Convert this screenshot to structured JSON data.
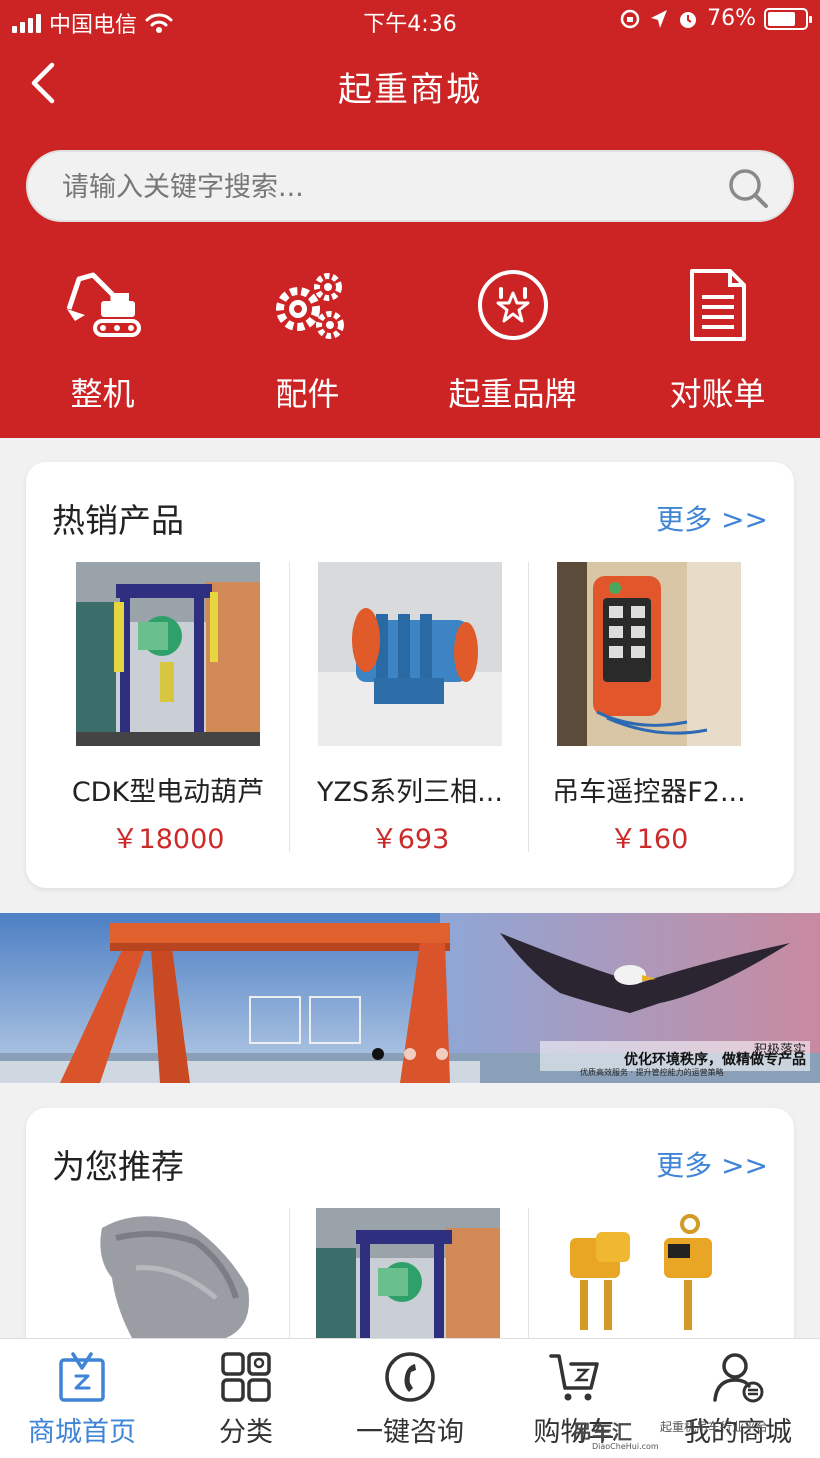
{
  "status_bar": {
    "carrier": "中国电信",
    "time": "下午4:36",
    "battery": "76%"
  },
  "nav": {
    "title": "起重商城"
  },
  "search": {
    "placeholder": "请输入关键字搜索..."
  },
  "quick_entries": [
    {
      "label": "整机",
      "icon": "excavator-icon"
    },
    {
      "label": "配件",
      "icon": "gears-icon"
    },
    {
      "label": "起重品牌",
      "icon": "star-badge-icon"
    },
    {
      "label": "对账单",
      "icon": "document-icon"
    }
  ],
  "hot_products": {
    "title": "热销产品",
    "more": "更多 >>",
    "items": [
      {
        "name": "CDK型电动葫芦",
        "price": "￥18000"
      },
      {
        "name": "YZS系列三相...",
        "price": "￥693"
      },
      {
        "name": "吊车遥控器F2...",
        "price": "￥160"
      }
    ]
  },
  "banner": {
    "slogan": "优化环境秩序，做精做专产品",
    "tag": "积极落实",
    "sub": "优质高效服务 · 提升管控能力的运营策略",
    "active_slide": 1
  },
  "recommend": {
    "title": "为您推荐",
    "more": "更多 >>"
  },
  "tabbar": [
    {
      "label": "商城首页",
      "icon": "shop-bag-icon",
      "active": true
    },
    {
      "label": "分类",
      "icon": "category-grid-icon",
      "active": false
    },
    {
      "label": "一键咨询",
      "icon": "phone-icon",
      "active": false
    },
    {
      "label": "购物车",
      "icon": "cart-icon",
      "active": false
    },
    {
      "label": "我的商城",
      "icon": "user-icon",
      "active": false
    }
  ],
  "watermark": {
    "brand": "吊车汇",
    "domain": "DiaoCheHui.com",
    "caption": "起重机吊车行业平台"
  },
  "colors": {
    "primary_red": "#cc2424",
    "link_blue": "#3f84d6",
    "price_red": "#cc2a2a"
  }
}
